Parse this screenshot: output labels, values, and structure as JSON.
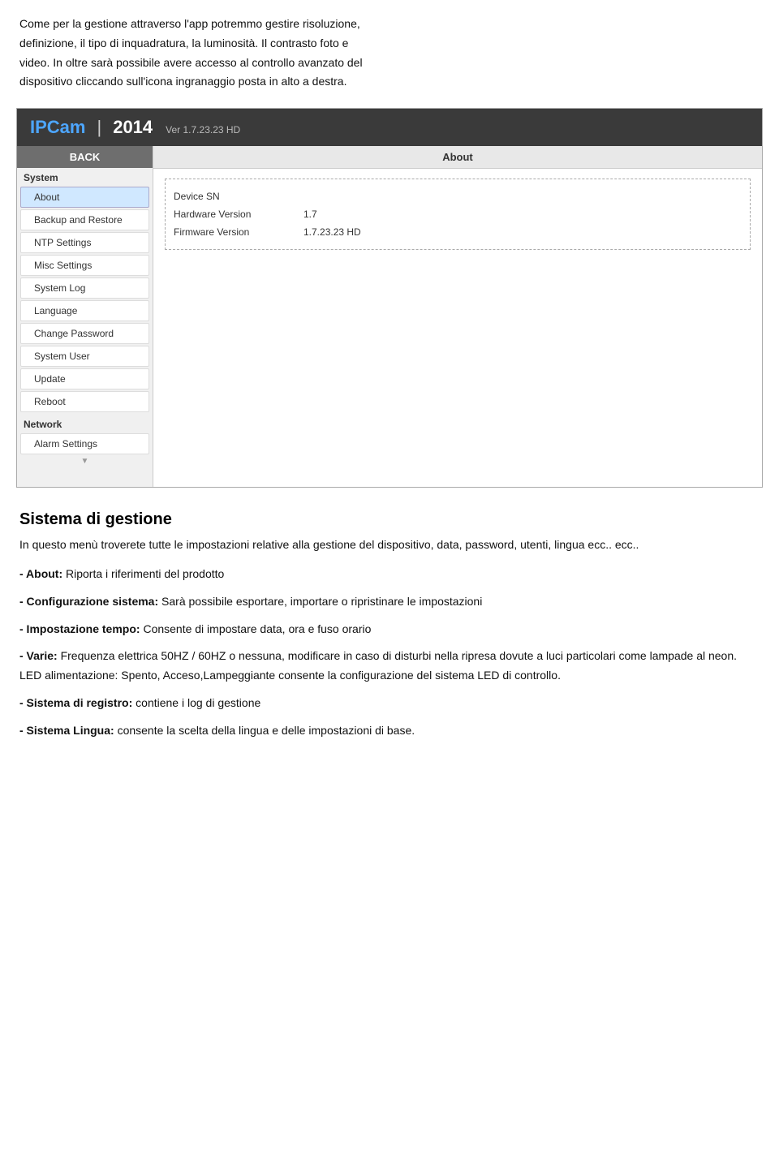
{
  "intro": {
    "line1": "Come per la gestione attraverso l'app potremmo gestire risoluzione,",
    "line2": "definizione, il tipo di inquadratura, la luminosità. Il contrasto foto e",
    "line3": "video. In oltre sarà possibile avere accesso al controllo avanzato del",
    "line4": "dispositivo cliccando sull'icona ingranaggio posta in alto a destra."
  },
  "ipcam": {
    "brand": "IPCam",
    "separator": "|",
    "year": "2014",
    "version": "Ver  1.7.23.23 HD",
    "back_label": "BACK",
    "sidebar": {
      "system_label": "System",
      "items": [
        {
          "label": "About",
          "active": true
        },
        {
          "label": "Backup and Restore",
          "active": false
        },
        {
          "label": "NTP Settings",
          "active": false
        },
        {
          "label": "Misc Settings",
          "active": false
        },
        {
          "label": "System Log",
          "active": false
        },
        {
          "label": "Language",
          "active": false
        },
        {
          "label": "Change Password",
          "active": false
        },
        {
          "label": "System User",
          "active": false
        },
        {
          "label": "Update",
          "active": false
        },
        {
          "label": "Reboot",
          "active": false
        }
      ],
      "network_label": "Network",
      "alarm_label": "Alarm Settings",
      "scroll_indicator": "▼"
    },
    "main": {
      "section_title": "About",
      "rows": [
        {
          "label": "Device SN",
          "value": ""
        },
        {
          "label": "Hardware Version",
          "value": "1.7"
        },
        {
          "label": "Firmware Version",
          "value": "1.7.23.23 HD"
        }
      ]
    }
  },
  "bottom": {
    "heading": "Sistema di gestione",
    "intro": "In questo menù troverete tutte le impostazioni relative alla gestione del dispositivo, data, password, utenti, lingua ecc.. ecc..",
    "features": [
      {
        "title": "- About:",
        "text": " Riporta i riferimenti del prodotto"
      },
      {
        "title": "- Configurazione sistema:",
        "text": " Sarà possibile esportare, importare o ripristinare le impostazioni"
      },
      {
        "title": "- Impostazione tempo:",
        "text": " Consente di impostare data, ora e fuso orario"
      },
      {
        "title": "- Varie:",
        "text": " Frequenza elettrica 50HZ / 60HZ o nessuna, modificare in caso di disturbi nella ripresa dovute a luci particolari come lampade al neon. LED alimentazione: Spento, Acceso,Lampeggiante consente la configurazione del sistema LED di controllo."
      },
      {
        "title": "- Sistema di registro:",
        "text": " contiene i log di gestione"
      },
      {
        "title": "- Sistema Lingua:",
        "text": " consente la scelta della lingua e delle impostazioni di base."
      }
    ]
  }
}
